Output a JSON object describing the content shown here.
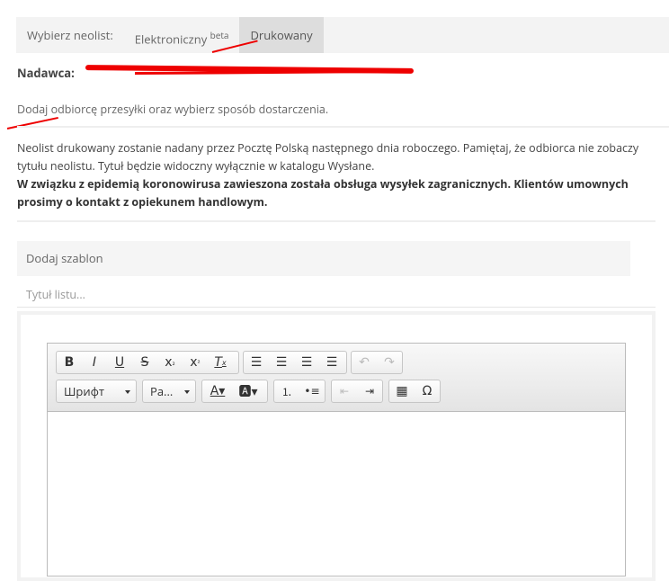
{
  "tabs": {
    "label": "Wybierz neolist:",
    "electronic": "Elektroniczny",
    "electronic_sup": "beta",
    "printed": "Drukowany"
  },
  "sender": {
    "label": "Nadawca:"
  },
  "hint": "Dodaj odbiorcę przesyłki oraz wybierz sposób dostarczenia.",
  "info": {
    "text": "Neolist drukowany zostanie nadany przez Pocztę Polską następnego dnia roboczego. Pamiętaj, że odbiorca nie zobaczy tytułu neolistu. Tytuł będzie widoczny wyłącznie w katalogu Wysłane.",
    "bold": "W związku z epidemią koronowirusa zawieszona została obsługa wysyłek zagranicznych. Klientów umownych prosimy o kontakt z opiekunem handlowym."
  },
  "template_label": "Dodaj szablon",
  "title_placeholder": "Tytuł listu...",
  "editor": {
    "font_combo": "Шрифт",
    "size_combo": "Ра..."
  },
  "colors": {
    "accent": "#3a8cd6",
    "annotation": "#ee0000"
  }
}
